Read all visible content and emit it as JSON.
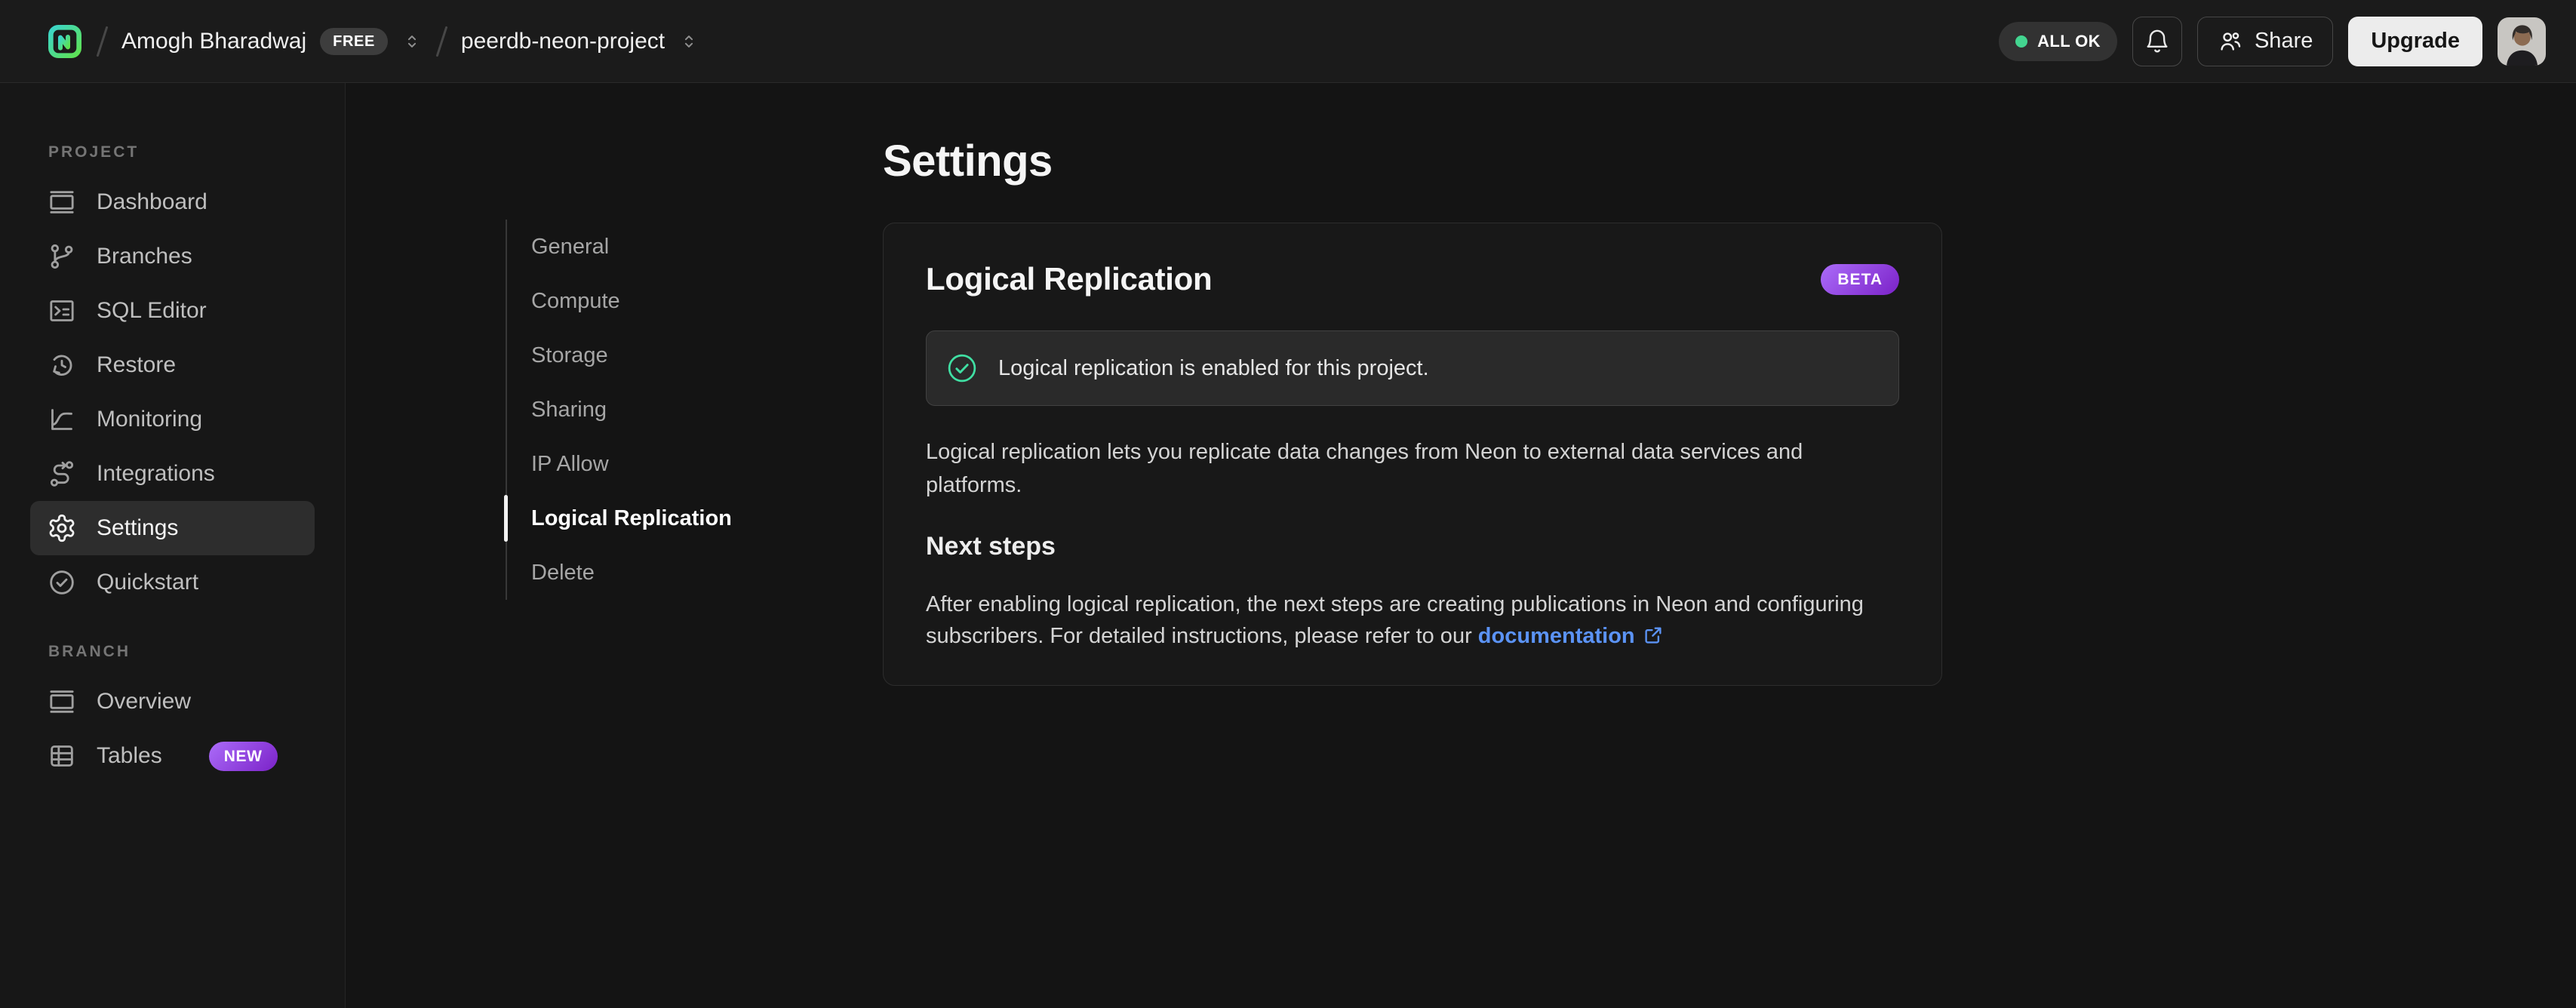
{
  "header": {
    "breadcrumb": {
      "org": "Amogh Bharadwaj",
      "org_badge": "FREE",
      "project": "peerdb-neon-project"
    },
    "status": "ALL OK",
    "share_label": "Share",
    "upgrade_label": "Upgrade"
  },
  "sidebar": {
    "project_section": "PROJECT",
    "project_items": [
      {
        "label": "Dashboard",
        "icon": "dashboard-icon",
        "active": false
      },
      {
        "label": "Branches",
        "icon": "branches-icon",
        "active": false
      },
      {
        "label": "SQL Editor",
        "icon": "sql-editor-icon",
        "active": false
      },
      {
        "label": "Restore",
        "icon": "restore-icon",
        "active": false
      },
      {
        "label": "Monitoring",
        "icon": "monitoring-icon",
        "active": false
      },
      {
        "label": "Integrations",
        "icon": "integrations-icon",
        "active": false
      },
      {
        "label": "Settings",
        "icon": "gear-icon",
        "active": true
      },
      {
        "label": "Quickstart",
        "icon": "check-circle-icon",
        "active": false
      }
    ],
    "branch_section": "BRANCH",
    "branch_items": [
      {
        "label": "Overview",
        "icon": "overview-icon",
        "badge": ""
      },
      {
        "label": "Tables",
        "icon": "tables-icon",
        "badge": "NEW"
      }
    ]
  },
  "settings_nav": {
    "active_index": 5,
    "items": [
      {
        "label": "General"
      },
      {
        "label": "Compute"
      },
      {
        "label": "Storage"
      },
      {
        "label": "Sharing"
      },
      {
        "label": "IP Allow"
      },
      {
        "label": "Logical Replication"
      },
      {
        "label": "Delete"
      }
    ]
  },
  "main": {
    "page_title": "Settings",
    "card": {
      "title": "Logical Replication",
      "badge": "BETA",
      "alert_text": "Logical replication is enabled for this project.",
      "description": "Logical replication lets you replicate data changes from Neon to external data services and platforms.",
      "next_steps_title": "Next steps",
      "next_steps_text": "After enabling logical replication, the next steps are creating publications in Neon and configuring subscribers. For detailed instructions, please refer to our ",
      "link_label": "documentation"
    }
  },
  "colors": {
    "accent_green": "#40dfa3",
    "status_dot_green": "#43d590",
    "badge_purple_start": "#ab6cf9",
    "badge_purple_end": "#7b22c8",
    "link_blue": "#5b93f5",
    "logo_gradient_start": "#3bd5cc",
    "logo_gradient_end": "#5fe24f"
  }
}
